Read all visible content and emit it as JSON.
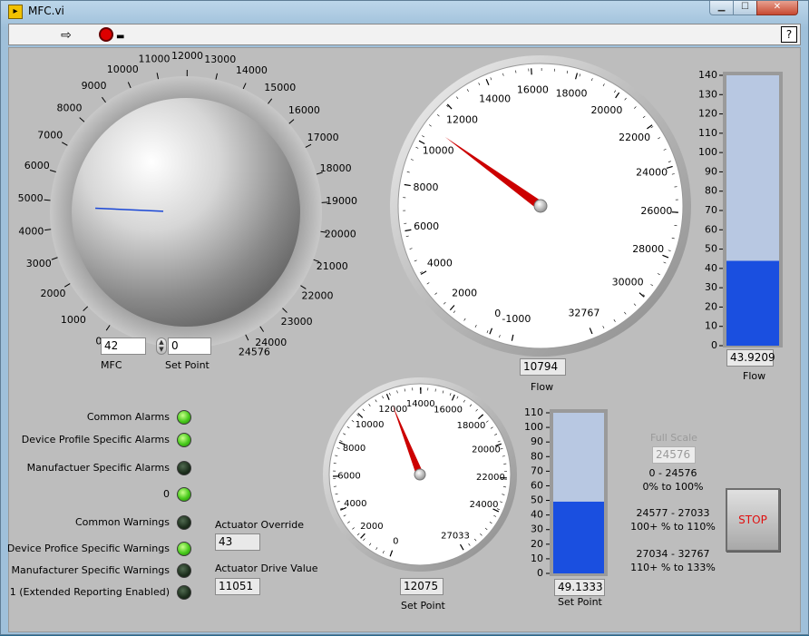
{
  "window": {
    "title": "MFC.vi",
    "help_label": "?",
    "minimize_glyph": "▁",
    "maximize_glyph": "☐",
    "close_glyph": "✕",
    "run_glyph": "⇨",
    "run_icon": "run-arrow-icon",
    "abort_icon": "abort-stop-icon",
    "pause_glyph": "▬"
  },
  "knob": {
    "label": "MFC",
    "value": "42",
    "ticks": [
      "0",
      "1000",
      "2000",
      "3000",
      "4000",
      "5000",
      "6000",
      "7000",
      "8000",
      "9000",
      "10000",
      "11000",
      "12000",
      "13000",
      "14000",
      "15000",
      "16000",
      "17000",
      "18000",
      "19000",
      "20000",
      "21000",
      "22000",
      "23000",
      "24000",
      "24576"
    ],
    "needle_value": 4800,
    "min": 0,
    "max": 24576
  },
  "set_point_input": {
    "label": "Set Point",
    "value": "0"
  },
  "flow_gauge": {
    "label": "Flow",
    "value": "10794",
    "needle_value": 10794,
    "ticks": [
      "-1000",
      "0",
      "2000",
      "4000",
      "6000",
      "8000",
      "10000",
      "12000",
      "14000",
      "16000",
      "18000",
      "20000",
      "22000",
      "24000",
      "26000",
      "28000",
      "30000",
      "32767"
    ]
  },
  "flow_tank": {
    "label": "Flow",
    "value": "43.9209",
    "fill_value": 43.9209,
    "max": 140,
    "ticks": [
      "0",
      "10",
      "20",
      "30",
      "40",
      "50",
      "60",
      "70",
      "80",
      "90",
      "100",
      "110",
      "120",
      "130",
      "140"
    ]
  },
  "setpoint_gauge": {
    "label": "Set Point",
    "value": "12075",
    "needle_value": 12075,
    "ticks": [
      "0",
      "2000",
      "4000",
      "6000",
      "8000",
      "10000",
      "12000",
      "14000",
      "16000",
      "18000",
      "20000",
      "22000",
      "24000",
      "27033"
    ]
  },
  "setpoint_tank": {
    "label": "Set Point",
    "value": "49.1333",
    "fill_value": 49.1333,
    "max": 110,
    "ticks": [
      "0",
      "10",
      "20",
      "30",
      "40",
      "50",
      "60",
      "70",
      "80",
      "90",
      "100",
      "110"
    ]
  },
  "alarms": [
    {
      "label": "Common Alarms",
      "state": "on"
    },
    {
      "label": "Device Profile Specific Alarms",
      "state": "on"
    },
    {
      "label": "Manufactuer Specific Alarms",
      "state": "off"
    },
    {
      "label": "0",
      "state": "on"
    },
    {
      "label": "Common Warnings",
      "state": "off"
    },
    {
      "label": "Device Profice Specific Warnings",
      "state": "on"
    },
    {
      "label": "Manufacturer Specific Warnings",
      "state": "off"
    },
    {
      "label": "1 (Extended Reporting Enabled)",
      "state": "off"
    }
  ],
  "actuator_override": {
    "label": "Actuator Override",
    "value": "43"
  },
  "actuator_drive": {
    "label": "Actuator Drive Value",
    "value": "11051"
  },
  "full_scale": {
    "label": "Full Scale",
    "value": "24576",
    "ranges": [
      {
        "range": "0    -  24576",
        "pct": "0% to  100%"
      },
      {
        "range": "24577  - 27033",
        "pct": "100+ % to 110%"
      },
      {
        "range": "27034  - 32767",
        "pct": "110+ % to 133%"
      }
    ]
  },
  "stop_button": {
    "label": "STOP"
  },
  "colors": {
    "panel": "#bdbdbd",
    "tank_fill": "#1a4fe0",
    "tank_empty": "#b8c8e2",
    "needle": "#cc0000",
    "knob_marker": "#1a47d6",
    "led_on": "#46c91a",
    "led_off": "#1c2e1c",
    "stop_text": "#e01010"
  }
}
